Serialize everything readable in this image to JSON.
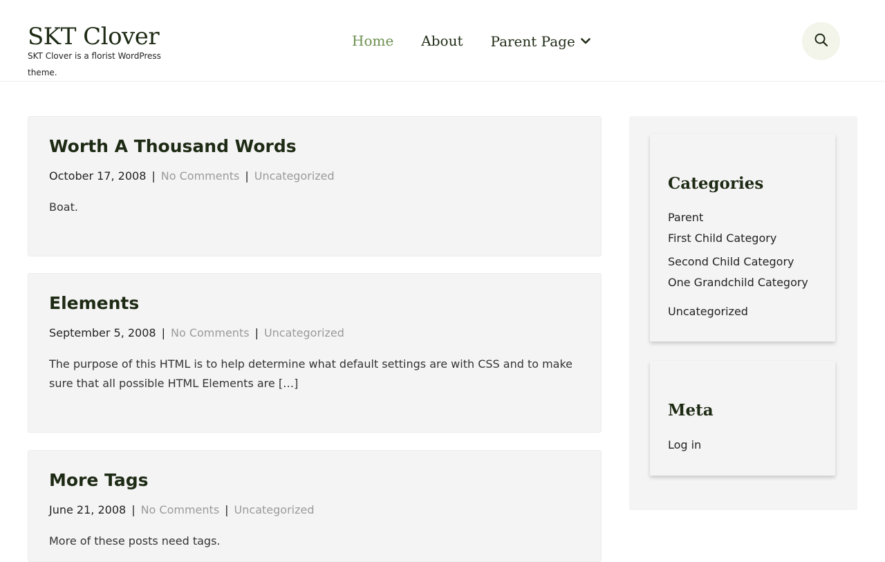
{
  "site": {
    "title": "SKT Clover",
    "tagline": "SKT Clover is a florist WordPress theme."
  },
  "nav": {
    "items": [
      {
        "label": "Home"
      },
      {
        "label": "About"
      },
      {
        "label": "Parent Page"
      }
    ]
  },
  "icons": {
    "search": "search-icon",
    "chevron": "chevron-down-icon"
  },
  "colors": {
    "accent": "#6b8f4e",
    "heading": "#1d2a14",
    "muted": "#9a9a9a",
    "card_bg": "#f5f4f4"
  },
  "posts": [
    {
      "title": "Worth A Thousand Words",
      "date": "October 17, 2008",
      "comments": "No Comments",
      "category": "Uncategorized",
      "excerpt": "Boat."
    },
    {
      "title": "Elements",
      "date": "September 5, 2008",
      "comments": "No Comments",
      "category": "Uncategorized",
      "excerpt": "The purpose of this HTML is to help determine what default settings are with CSS and to make sure that all possible HTML Elements are […]"
    },
    {
      "title": "More Tags",
      "date": "June 21, 2008",
      "comments": "No Comments",
      "category": "Uncategorized",
      "excerpt": "More of these posts need tags."
    }
  ],
  "sidebar": {
    "categories": {
      "title": "Categories",
      "items": [
        {
          "label": "Parent"
        },
        {
          "label": "First Child Category"
        },
        {
          "label": "Second Child Category"
        },
        {
          "label": "One Grandchild Category"
        },
        {
          "label": "Uncategorized"
        }
      ]
    },
    "meta": {
      "title": "Meta",
      "items": [
        {
          "label": "Log in"
        }
      ]
    }
  }
}
